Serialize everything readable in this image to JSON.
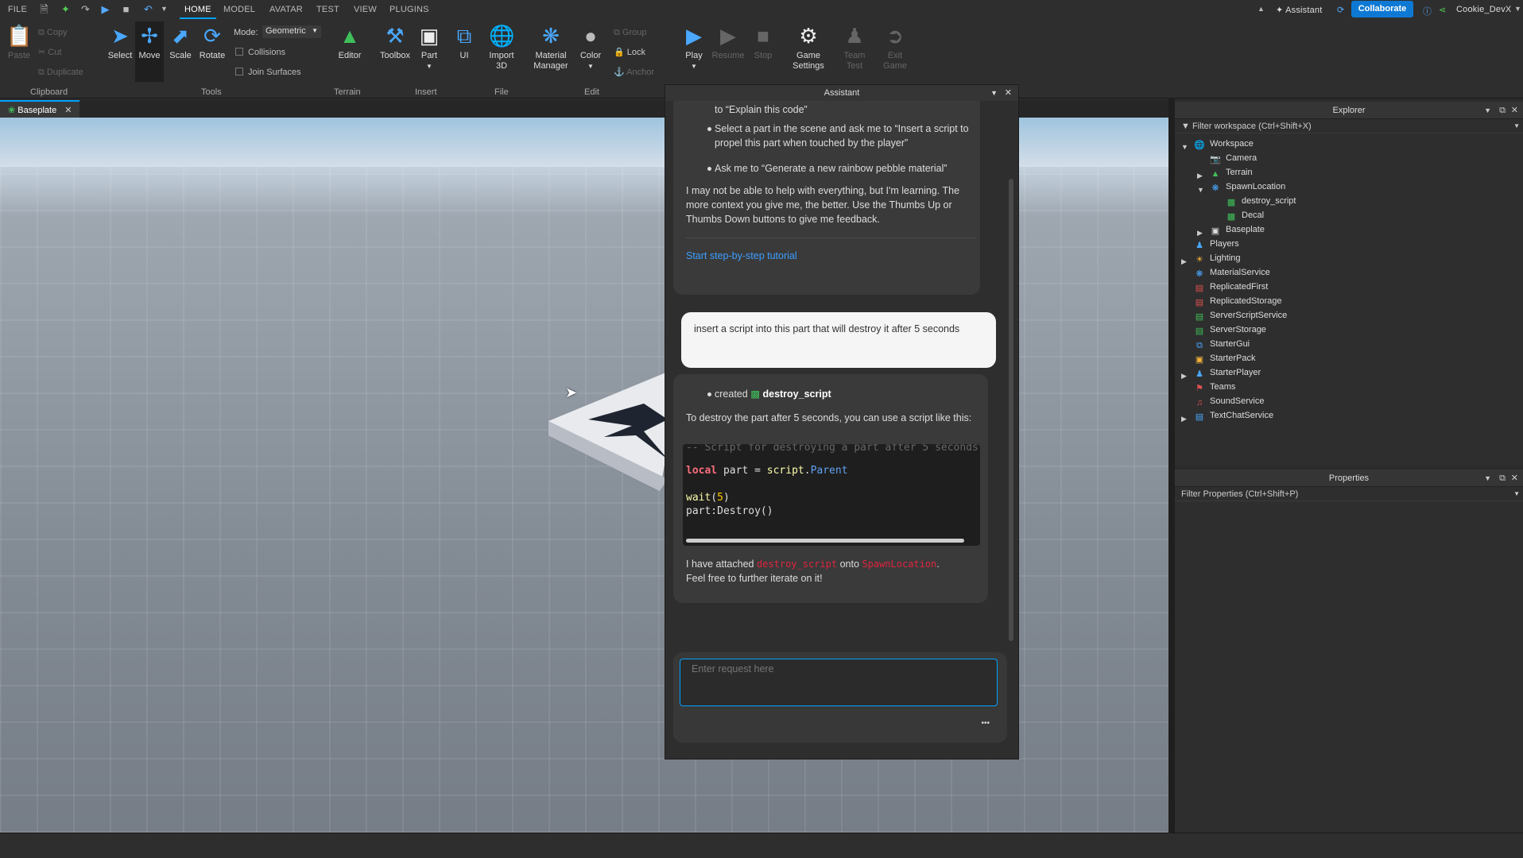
{
  "menubar": {
    "file": "FILE",
    "tabs": [
      "HOME",
      "MODEL",
      "AVATAR",
      "TEST",
      "VIEW",
      "PLUGINS"
    ],
    "active_tab": "HOME",
    "assistant": "Assistant",
    "collaborate": "Collaborate",
    "user": "Cookie_DevX"
  },
  "ribbon": {
    "clipboard": {
      "paste": "Paste",
      "copy": "Copy",
      "cut": "Cut",
      "duplicate": "Duplicate",
      "group": "Clipboard"
    },
    "tools": {
      "select": "Select",
      "move": "Move",
      "scale": "Scale",
      "rotate": "Rotate",
      "mode_label": "Mode:",
      "mode_value": "Geometric",
      "collisions": "Collisions",
      "join_surfaces": "Join Surfaces",
      "group": "Tools"
    },
    "terrain": {
      "editor": "Editor",
      "group": "Terrain"
    },
    "insert": {
      "toolbox": "Toolbox",
      "part": "Part",
      "ui": "UI",
      "group": "Insert"
    },
    "file": {
      "import3d": "Import 3D",
      "group": "File"
    },
    "edit": {
      "material_manager": "Material Manager",
      "color": "Color",
      "group_btn": "Group",
      "lock": "Lock",
      "anchor": "Anchor",
      "group": "Edit"
    },
    "test": {
      "play": "Play",
      "resume": "Resume",
      "stop": "Stop",
      "game_settings": "Game Settings",
      "team_test": "Team Test",
      "exit_game": "Exit Game"
    }
  },
  "doc_tab": {
    "label": "Baseplate"
  },
  "assistant": {
    "title": "Assistant",
    "intro_line": "to “Explain this code”",
    "bullets": [
      "Select a part in the scene and ask me to “Insert a script to propel this part when touched by the player”",
      "Ask me to “Generate a new rainbow pebble material”"
    ],
    "disclaimer": "I may not be able to help with everything, but I'm learning. The more context you give me, the better. Use the Thumbs Up or Thumbs Down buttons to give me feedback.",
    "tutorial_link": "Start step-by-step tutorial",
    "user_message": "insert a script into this part that will destroy it after 5 seconds",
    "created_label": "created",
    "created_name": "destroy_script",
    "explain": "To destroy the part after 5 seconds, you can use a script like this:",
    "code_comment": "-- Script for destroying a part after 5 seconds",
    "code": {
      "local": "local",
      "part_assign": " part = ",
      "script": "script",
      "dot": ".",
      "parent": "Parent",
      "wait": "wait",
      "lp": "(",
      "five": "5",
      "rp": ")",
      "destroy": "part:Destroy()"
    },
    "attached_pre": "I have attached ",
    "attached_script": "destroy_script",
    "attached_mid": " onto ",
    "attached_target": "SpawnLocation",
    "attached_post": ".",
    "iterate": "Feel free to further iterate on it!",
    "input_placeholder": "Enter request here",
    "more": "•••"
  },
  "explorer": {
    "title": "Explorer",
    "filter": "Filter workspace (Ctrl+Shift+X)",
    "items": [
      "Workspace",
      "Camera",
      "Terrain",
      "SpawnLocation",
      "destroy_script",
      "Decal",
      "Baseplate",
      "Players",
      "Lighting",
      "MaterialService",
      "ReplicatedFirst",
      "ReplicatedStorage",
      "ServerScriptService",
      "ServerStorage",
      "StarterGui",
      "StarterPack",
      "StarterPlayer",
      "Teams",
      "SoundService",
      "TextChatService"
    ]
  },
  "properties": {
    "title": "Properties",
    "filter": "Filter Properties (Ctrl+Shift+P)"
  },
  "colors": {
    "accent": "#00a2ff",
    "link": "#3d9eff",
    "keyword": "#f86d7c",
    "error_red": "#e0243e"
  }
}
